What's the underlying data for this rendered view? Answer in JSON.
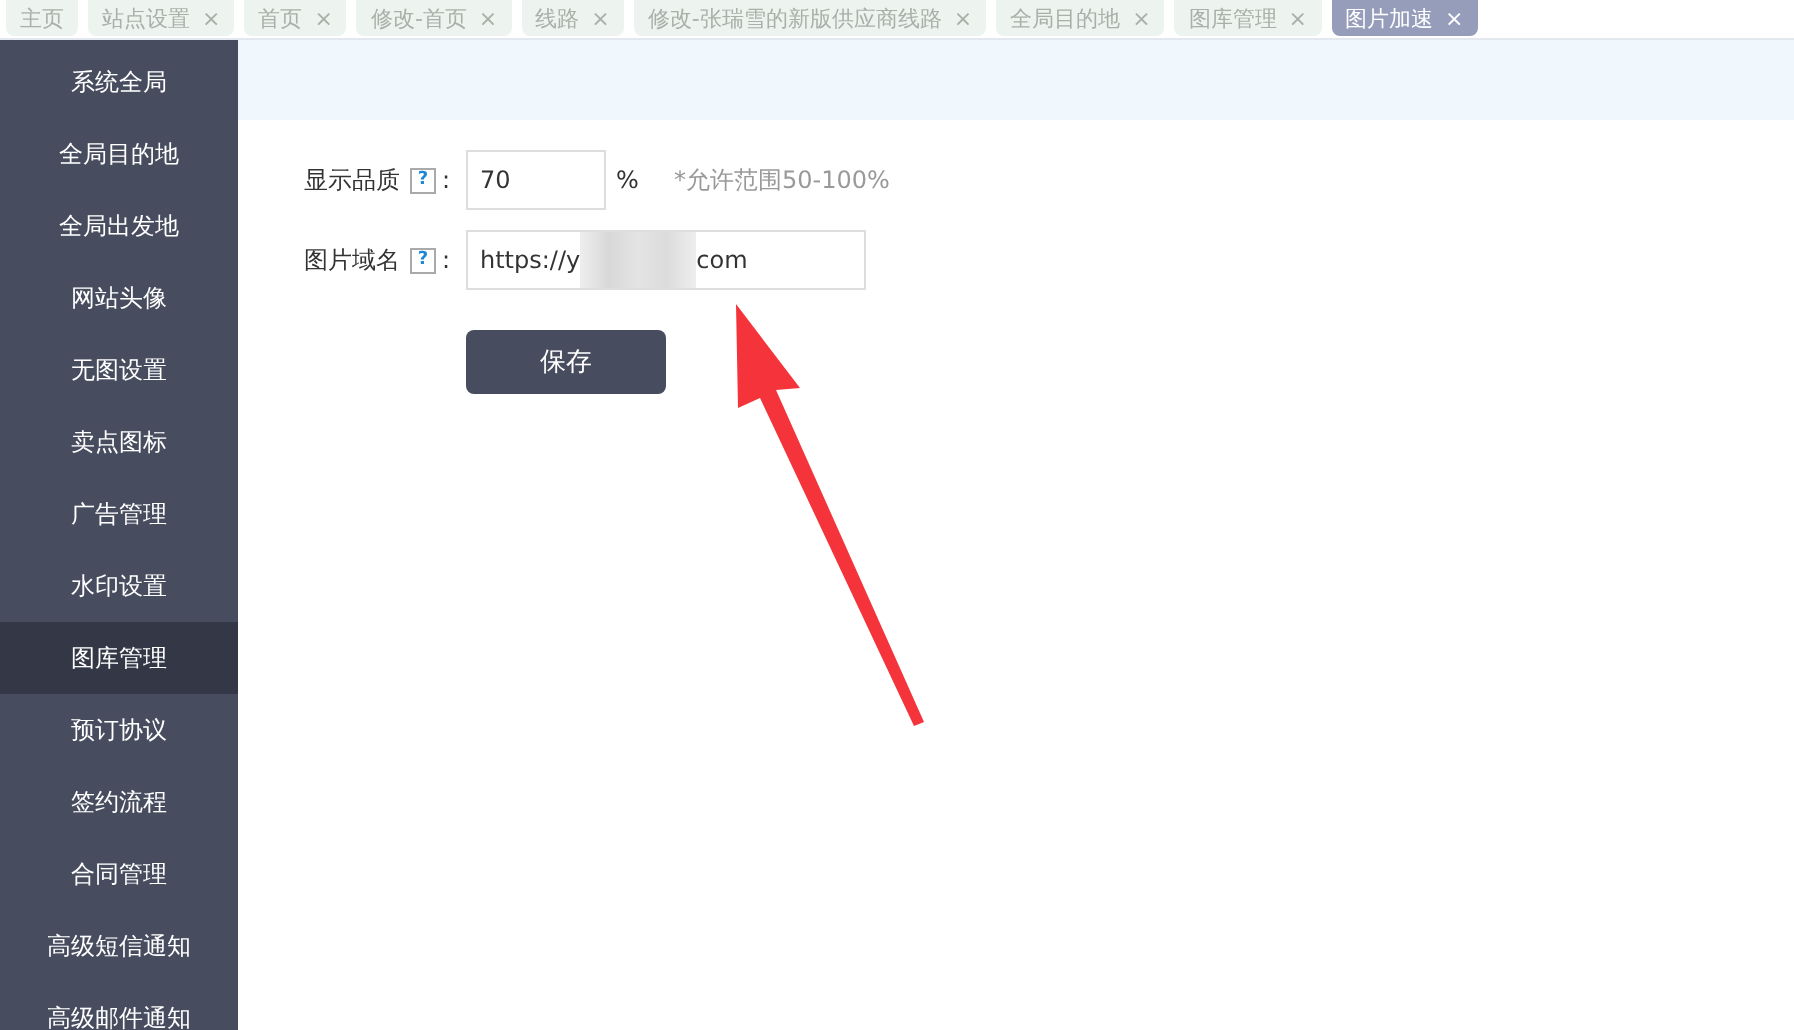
{
  "tabs": [
    {
      "label": "主页",
      "selected": false
    },
    {
      "label": "站点设置",
      "close": "×",
      "selected": false
    },
    {
      "label": "首页",
      "close": "×",
      "selected": false
    },
    {
      "label": "修改-首页",
      "close": "×",
      "selected": false
    },
    {
      "label": "线路",
      "close": "×",
      "selected": false
    },
    {
      "label": "修改-张瑞雪的新版供应商线路",
      "close": "×",
      "selected": false
    },
    {
      "label": "全局目的地",
      "close": "×",
      "selected": false
    },
    {
      "label": "图库管理",
      "close": "×",
      "selected": false
    },
    {
      "label": "图片加速",
      "close": "×",
      "selected": true
    }
  ],
  "sidebar": {
    "items": [
      {
        "label": "系统全局",
        "selected": false
      },
      {
        "label": "全局目的地",
        "selected": false
      },
      {
        "label": "全局出发地",
        "selected": false
      },
      {
        "label": "网站头像",
        "selected": false
      },
      {
        "label": "无图设置",
        "selected": false
      },
      {
        "label": "卖点图标",
        "selected": false
      },
      {
        "label": "广告管理",
        "selected": false
      },
      {
        "label": "水印设置",
        "selected": false
      },
      {
        "label": "图库管理",
        "selected": true
      },
      {
        "label": "预订协议",
        "selected": false
      },
      {
        "label": "签约流程",
        "selected": false
      },
      {
        "label": "合同管理",
        "selected": false
      },
      {
        "label": "高级短信通知",
        "selected": false
      },
      {
        "label": "高级邮件通知",
        "selected": false
      }
    ]
  },
  "form": {
    "fields": [
      {
        "label": "显示品质",
        "help": "?",
        "value": "70",
        "unit": "%",
        "note": "*允许范围50-100%"
      },
      {
        "label": "图片域名",
        "help": "?",
        "value": "https://y",
        "value_end": "com"
      }
    ],
    "colon": ":",
    "save_button": "保存"
  },
  "annotation": {
    "kind": "arrow"
  }
}
